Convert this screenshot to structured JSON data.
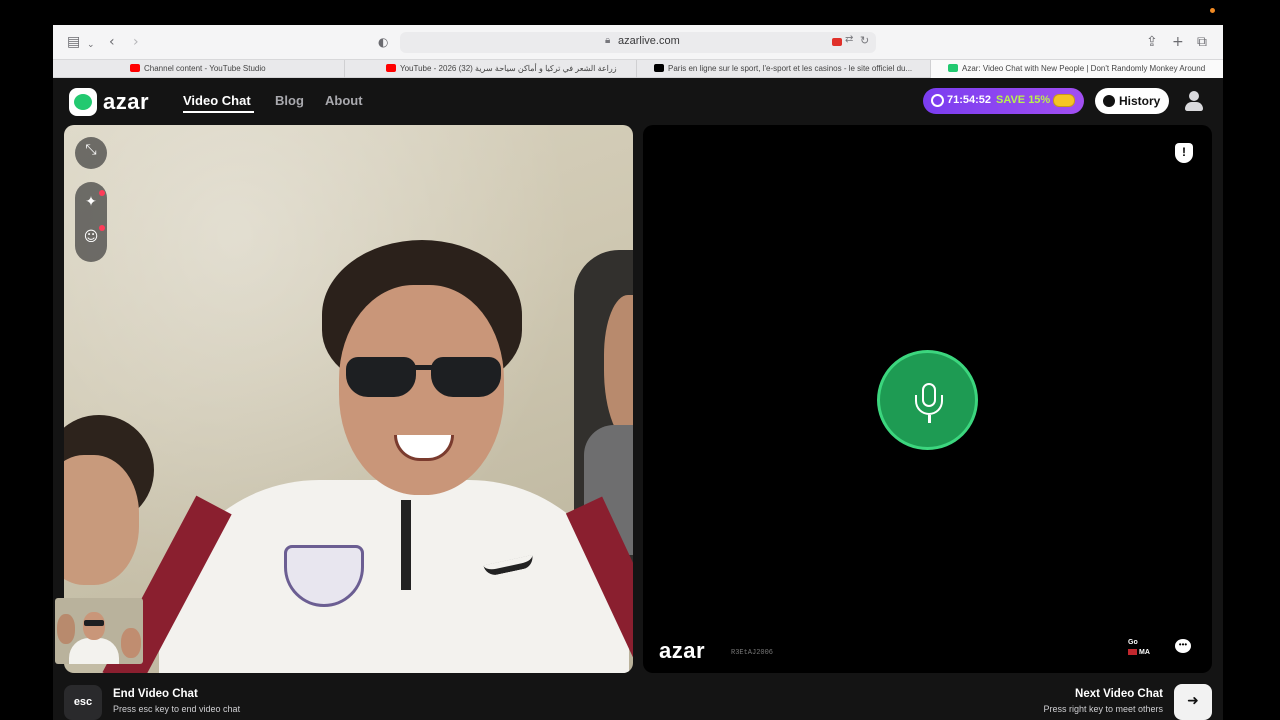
{
  "browser": {
    "url": "azarlive.com",
    "tabs": [
      {
        "label": "Channel content - YouTube Studio",
        "favicon_color": "#ff0000"
      },
      {
        "label": "YouTube - 2026 زراعة الشعر في تركيا و أماكن سياحة سرية (32)",
        "favicon_color": "#ff0000"
      },
      {
        "label": "Paris en ligne sur le sport, l'e-sport et les casinos - le site officiel du...",
        "favicon_color": "#000000"
      },
      {
        "label": "Azar: Video Chat with New People | Don't Randomly Monkey Around",
        "favicon_color": "#22c970"
      }
    ],
    "icons": {
      "sidebar": "sidebar-icon",
      "back": "chevron-left-icon",
      "forward": "chevron-right-icon",
      "shield": "shield-icon",
      "share": "share-icon",
      "new_tab": "plus-icon",
      "tabs_overview": "tabs-icon"
    }
  },
  "app": {
    "brand": "azar",
    "nav": [
      {
        "label": "Video Chat",
        "active": true
      },
      {
        "label": "Blog",
        "active": false
      },
      {
        "label": "About",
        "active": false
      }
    ],
    "promo": {
      "timer": "71:54:52",
      "offer": "SAVE 15%"
    },
    "history_label": "History",
    "accent_color": "#22c970"
  },
  "right_panel": {
    "brand": "azar",
    "user_id": "R3EtAJ2006",
    "country_line1": "Go",
    "country_line2": "MA",
    "mic_state": "active"
  },
  "footer": {
    "esc_key": "esc",
    "end_title": "End Video Chat",
    "end_subtitle": "Press esc key to end video chat",
    "next_title": "Next Video Chat",
    "next_subtitle": "Press right key to meet others",
    "next_key_symbol": "➜"
  }
}
